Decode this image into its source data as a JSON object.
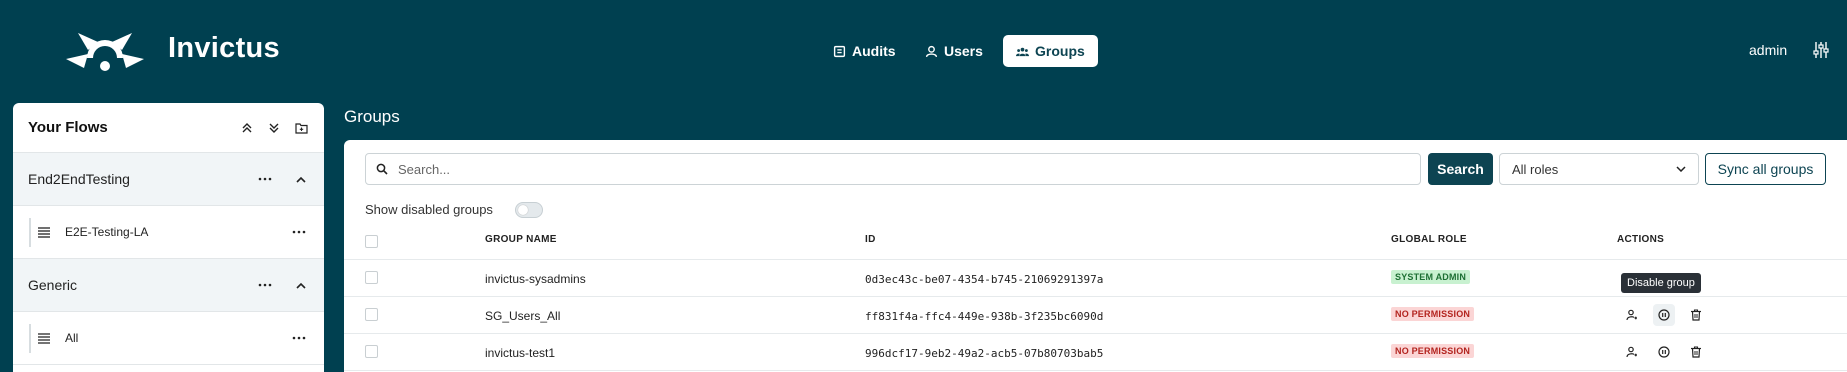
{
  "app": {
    "brand": "Invictus",
    "user": "admin"
  },
  "nav": {
    "audits": "Audits",
    "users": "Users",
    "groups": "Groups"
  },
  "sidebar": {
    "title": "Your Flows",
    "groups": [
      {
        "label": "End2EndTesting",
        "items": [
          {
            "label": "E2E-Testing-LA"
          }
        ]
      },
      {
        "label": "Generic",
        "items": [
          {
            "label": "All"
          }
        ]
      }
    ]
  },
  "main": {
    "title": "Groups",
    "search": {
      "placeholder": "Search...",
      "value": "",
      "button": "Search"
    },
    "role_filter": {
      "selected": "All roles"
    },
    "sync_button": "Sync all groups",
    "show_disabled": {
      "label": "Show disabled groups",
      "checked": false
    },
    "columns": {
      "name": "GROUP NAME",
      "id": "ID",
      "role": "GLOBAL ROLE",
      "actions": "ACTIONS"
    },
    "rows": [
      {
        "name": "invictus-sysadmins",
        "id": "0d3ec43c-be07-4354-b745-21069291397a",
        "role": "SYSTEM ADMIN",
        "role_type": "admin"
      },
      {
        "name": "SG_Users_All",
        "id": "ff831f4a-ffc4-449e-938b-3f235bc6090d",
        "role": "NO PERMISSION",
        "role_type": "none"
      },
      {
        "name": "invictus-test1",
        "id": "996dcf17-9eb2-49a2-acb5-07b80703bab5",
        "role": "NO PERMISSION",
        "role_type": "none"
      }
    ],
    "tooltip": "Disable group"
  },
  "colors": {
    "header_bg": "#004050",
    "primary": "#0d4452",
    "admin_badge_bg": "#c8f1d0",
    "none_badge_bg": "#fbd5d5"
  }
}
